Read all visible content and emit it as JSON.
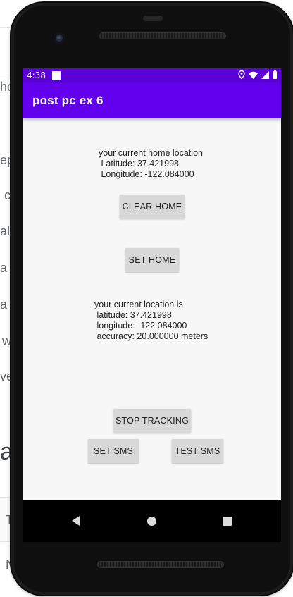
{
  "background_page": {
    "fragments": [
      "ho",
      "ep",
      "c",
      "al",
      "a",
      "a",
      "w",
      "ve",
      "at",
      "T",
      "N"
    ]
  },
  "status_bar": {
    "time": "4:38",
    "icons": [
      "location-icon",
      "wifi-icon",
      "signal-icon",
      "battery-icon"
    ]
  },
  "app_bar": {
    "title": "post pc ex 6"
  },
  "home_location": {
    "heading": "your current home location",
    "latitude": " Latitude: 37.421998",
    "longitude": " Longitude: -122.084000"
  },
  "buttons": {
    "clear_home": "CLEAR HOME",
    "set_home": "SET HOME",
    "stop_tracking": "STOP TRACKING",
    "set_sms": "SET SMS",
    "test_sms": "TEST SMS"
  },
  "current_location": {
    "heading": "your current location is",
    "latitude": " latitude: 37.421998",
    "longitude": " longitude: -122.084000",
    "accuracy": " accuracy: 20.000000 meters"
  },
  "nav_bar": {
    "icons": [
      "back-icon",
      "home-icon",
      "recents-icon"
    ]
  },
  "colors": {
    "app_bar": "#6200ee",
    "status_bar": "#5b00d6",
    "button": "#d8d8d8",
    "screen_bg": "#f7f7f7"
  }
}
